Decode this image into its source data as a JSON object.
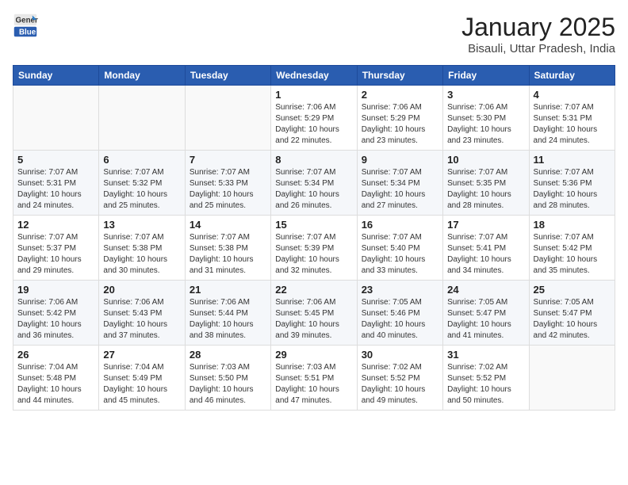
{
  "header": {
    "logo_general": "General",
    "logo_blue": "Blue",
    "title": "January 2025",
    "location": "Bisauli, Uttar Pradesh, India"
  },
  "days_of_week": [
    "Sunday",
    "Monday",
    "Tuesday",
    "Wednesday",
    "Thursday",
    "Friday",
    "Saturday"
  ],
  "weeks": [
    [
      {
        "day": "",
        "info": ""
      },
      {
        "day": "",
        "info": ""
      },
      {
        "day": "",
        "info": ""
      },
      {
        "day": "1",
        "info": "Sunrise: 7:06 AM\nSunset: 5:29 PM\nDaylight: 10 hours\nand 22 minutes."
      },
      {
        "day": "2",
        "info": "Sunrise: 7:06 AM\nSunset: 5:29 PM\nDaylight: 10 hours\nand 23 minutes."
      },
      {
        "day": "3",
        "info": "Sunrise: 7:06 AM\nSunset: 5:30 PM\nDaylight: 10 hours\nand 23 minutes."
      },
      {
        "day": "4",
        "info": "Sunrise: 7:07 AM\nSunset: 5:31 PM\nDaylight: 10 hours\nand 24 minutes."
      }
    ],
    [
      {
        "day": "5",
        "info": "Sunrise: 7:07 AM\nSunset: 5:31 PM\nDaylight: 10 hours\nand 24 minutes."
      },
      {
        "day": "6",
        "info": "Sunrise: 7:07 AM\nSunset: 5:32 PM\nDaylight: 10 hours\nand 25 minutes."
      },
      {
        "day": "7",
        "info": "Sunrise: 7:07 AM\nSunset: 5:33 PM\nDaylight: 10 hours\nand 25 minutes."
      },
      {
        "day": "8",
        "info": "Sunrise: 7:07 AM\nSunset: 5:34 PM\nDaylight: 10 hours\nand 26 minutes."
      },
      {
        "day": "9",
        "info": "Sunrise: 7:07 AM\nSunset: 5:34 PM\nDaylight: 10 hours\nand 27 minutes."
      },
      {
        "day": "10",
        "info": "Sunrise: 7:07 AM\nSunset: 5:35 PM\nDaylight: 10 hours\nand 28 minutes."
      },
      {
        "day": "11",
        "info": "Sunrise: 7:07 AM\nSunset: 5:36 PM\nDaylight: 10 hours\nand 28 minutes."
      }
    ],
    [
      {
        "day": "12",
        "info": "Sunrise: 7:07 AM\nSunset: 5:37 PM\nDaylight: 10 hours\nand 29 minutes."
      },
      {
        "day": "13",
        "info": "Sunrise: 7:07 AM\nSunset: 5:38 PM\nDaylight: 10 hours\nand 30 minutes."
      },
      {
        "day": "14",
        "info": "Sunrise: 7:07 AM\nSunset: 5:38 PM\nDaylight: 10 hours\nand 31 minutes."
      },
      {
        "day": "15",
        "info": "Sunrise: 7:07 AM\nSunset: 5:39 PM\nDaylight: 10 hours\nand 32 minutes."
      },
      {
        "day": "16",
        "info": "Sunrise: 7:07 AM\nSunset: 5:40 PM\nDaylight: 10 hours\nand 33 minutes."
      },
      {
        "day": "17",
        "info": "Sunrise: 7:07 AM\nSunset: 5:41 PM\nDaylight: 10 hours\nand 34 minutes."
      },
      {
        "day": "18",
        "info": "Sunrise: 7:07 AM\nSunset: 5:42 PM\nDaylight: 10 hours\nand 35 minutes."
      }
    ],
    [
      {
        "day": "19",
        "info": "Sunrise: 7:06 AM\nSunset: 5:42 PM\nDaylight: 10 hours\nand 36 minutes."
      },
      {
        "day": "20",
        "info": "Sunrise: 7:06 AM\nSunset: 5:43 PM\nDaylight: 10 hours\nand 37 minutes."
      },
      {
        "day": "21",
        "info": "Sunrise: 7:06 AM\nSunset: 5:44 PM\nDaylight: 10 hours\nand 38 minutes."
      },
      {
        "day": "22",
        "info": "Sunrise: 7:06 AM\nSunset: 5:45 PM\nDaylight: 10 hours\nand 39 minutes."
      },
      {
        "day": "23",
        "info": "Sunrise: 7:05 AM\nSunset: 5:46 PM\nDaylight: 10 hours\nand 40 minutes."
      },
      {
        "day": "24",
        "info": "Sunrise: 7:05 AM\nSunset: 5:47 PM\nDaylight: 10 hours\nand 41 minutes."
      },
      {
        "day": "25",
        "info": "Sunrise: 7:05 AM\nSunset: 5:47 PM\nDaylight: 10 hours\nand 42 minutes."
      }
    ],
    [
      {
        "day": "26",
        "info": "Sunrise: 7:04 AM\nSunset: 5:48 PM\nDaylight: 10 hours\nand 44 minutes."
      },
      {
        "day": "27",
        "info": "Sunrise: 7:04 AM\nSunset: 5:49 PM\nDaylight: 10 hours\nand 45 minutes."
      },
      {
        "day": "28",
        "info": "Sunrise: 7:03 AM\nSunset: 5:50 PM\nDaylight: 10 hours\nand 46 minutes."
      },
      {
        "day": "29",
        "info": "Sunrise: 7:03 AM\nSunset: 5:51 PM\nDaylight: 10 hours\nand 47 minutes."
      },
      {
        "day": "30",
        "info": "Sunrise: 7:02 AM\nSunset: 5:52 PM\nDaylight: 10 hours\nand 49 minutes."
      },
      {
        "day": "31",
        "info": "Sunrise: 7:02 AM\nSunset: 5:52 PM\nDaylight: 10 hours\nand 50 minutes."
      },
      {
        "day": "",
        "info": ""
      }
    ]
  ]
}
